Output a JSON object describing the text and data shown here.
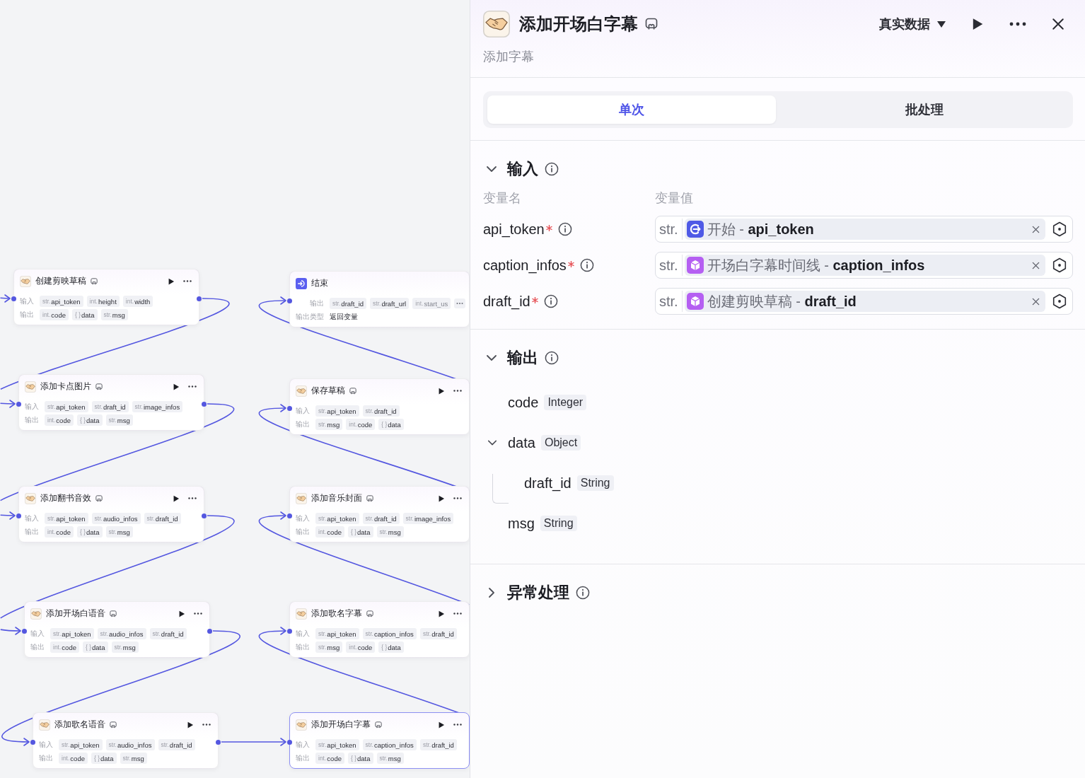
{
  "canvas": {
    "nodes": [
      {
        "kind": "plugin",
        "title": "创建剪映草稿",
        "selected": false,
        "rows": [
          {
            "kind": "params",
            "label": "输入",
            "params": [
              {
                "type": "str.",
                "name": "api_token"
              },
              {
                "type": "int.",
                "name": "height"
              },
              {
                "type": "int.",
                "name": "width"
              }
            ]
          },
          {
            "kind": "params",
            "label": "输出",
            "params": [
              {
                "type": "int.",
                "name": "code"
              },
              {
                "type": "{ }",
                "name": "data"
              },
              {
                "type": "str.",
                "name": "msg"
              }
            ]
          }
        ]
      },
      {
        "kind": "end",
        "title": "结束",
        "selected": false,
        "rows": [
          {
            "kind": "params",
            "label": "输出",
            "overflow": true,
            "params": [
              {
                "type": "str.",
                "name": "draft_id"
              },
              {
                "type": "str.",
                "name": "draft_url"
              },
              {
                "type": "int.",
                "name": "start_us"
              }
            ]
          },
          {
            "kind": "text",
            "label": "输出类型",
            "value": "返回变量"
          }
        ]
      },
      {
        "kind": "plugin",
        "title": "添加卡点图片",
        "selected": false,
        "rows": [
          {
            "kind": "params",
            "label": "输入",
            "params": [
              {
                "type": "str.",
                "name": "api_token"
              },
              {
                "type": "str.",
                "name": "draft_id"
              },
              {
                "type": "str.",
                "name": "image_infos"
              }
            ]
          },
          {
            "kind": "params",
            "label": "输出",
            "params": [
              {
                "type": "int.",
                "name": "code"
              },
              {
                "type": "{ }",
                "name": "data"
              },
              {
                "type": "str.",
                "name": "msg"
              }
            ]
          }
        ]
      },
      {
        "kind": "plugin",
        "title": "保存草稿",
        "selected": false,
        "rows": [
          {
            "kind": "params",
            "label": "输入",
            "params": [
              {
                "type": "str.",
                "name": "api_token"
              },
              {
                "type": "str.",
                "name": "draft_id"
              }
            ]
          },
          {
            "kind": "params",
            "label": "输出",
            "params": [
              {
                "type": "str.",
                "name": "msg"
              },
              {
                "type": "int.",
                "name": "code"
              },
              {
                "type": "{ }",
                "name": "data"
              }
            ]
          }
        ]
      },
      {
        "kind": "plugin",
        "title": "添加翻书音效",
        "selected": false,
        "rows": [
          {
            "kind": "params",
            "label": "输入",
            "params": [
              {
                "type": "str.",
                "name": "api_token"
              },
              {
                "type": "str.",
                "name": "audio_infos"
              },
              {
                "type": "str.",
                "name": "draft_id"
              }
            ]
          },
          {
            "kind": "params",
            "label": "输出",
            "params": [
              {
                "type": "int.",
                "name": "code"
              },
              {
                "type": "{ }",
                "name": "data"
              },
              {
                "type": "str.",
                "name": "msg"
              }
            ]
          }
        ]
      },
      {
        "kind": "plugin",
        "title": "添加音乐封面",
        "selected": false,
        "rows": [
          {
            "kind": "params",
            "label": "输入",
            "params": [
              {
                "type": "str.",
                "name": "api_token"
              },
              {
                "type": "str.",
                "name": "draft_id"
              },
              {
                "type": "str.",
                "name": "image_infos"
              }
            ]
          },
          {
            "kind": "params",
            "label": "输出",
            "params": [
              {
                "type": "int.",
                "name": "code"
              },
              {
                "type": "{ }",
                "name": "data"
              },
              {
                "type": "str.",
                "name": "msg"
              }
            ]
          }
        ]
      },
      {
        "kind": "plugin",
        "title": "添加开场白语音",
        "selected": false,
        "rows": [
          {
            "kind": "params",
            "label": "输入",
            "params": [
              {
                "type": "str.",
                "name": "api_token"
              },
              {
                "type": "str.",
                "name": "audio_infos"
              },
              {
                "type": "str.",
                "name": "draft_id"
              }
            ]
          },
          {
            "kind": "params",
            "label": "输出",
            "params": [
              {
                "type": "int.",
                "name": "code"
              },
              {
                "type": "{ }",
                "name": "data"
              },
              {
                "type": "str.",
                "name": "msg"
              }
            ]
          }
        ]
      },
      {
        "kind": "plugin",
        "title": "添加歌名字幕",
        "selected": false,
        "rows": [
          {
            "kind": "params",
            "label": "输入",
            "params": [
              {
                "type": "str.",
                "name": "api_token"
              },
              {
                "type": "str.",
                "name": "caption_infos"
              },
              {
                "type": "str.",
                "name": "draft_id"
              }
            ]
          },
          {
            "kind": "params",
            "label": "输出",
            "params": [
              {
                "type": "str.",
                "name": "msg"
              },
              {
                "type": "int.",
                "name": "code"
              },
              {
                "type": "{ }",
                "name": "data"
              }
            ]
          }
        ]
      },
      {
        "kind": "plugin",
        "title": "添加歌名语音",
        "selected": false,
        "rows": [
          {
            "kind": "params",
            "label": "输入",
            "params": [
              {
                "type": "str.",
                "name": "api_token"
              },
              {
                "type": "str.",
                "name": "audio_infos"
              },
              {
                "type": "str.",
                "name": "draft_id"
              }
            ]
          },
          {
            "kind": "params",
            "label": "输出",
            "params": [
              {
                "type": "int.",
                "name": "code"
              },
              {
                "type": "{ }",
                "name": "data"
              },
              {
                "type": "str.",
                "name": "msg"
              }
            ]
          }
        ]
      },
      {
        "kind": "plugin",
        "title": "添加开场白字幕",
        "selected": true,
        "rows": [
          {
            "kind": "params",
            "label": "输入",
            "params": [
              {
                "type": "str.",
                "name": "api_token"
              },
              {
                "type": "str.",
                "name": "caption_infos"
              },
              {
                "type": "str.",
                "name": "draft_id"
              }
            ]
          },
          {
            "kind": "params",
            "label": "输出",
            "params": [
              {
                "type": "int.",
                "name": "code"
              },
              {
                "type": "{ }",
                "name": "data"
              },
              {
                "type": "str.",
                "name": "msg"
              }
            ]
          }
        ]
      }
    ]
  },
  "panel": {
    "title": "添加开场白字幕",
    "subtitle": "添加字幕",
    "data_mode": "真实数据",
    "tabs": [
      {
        "label": "单次",
        "selected": true
      },
      {
        "label": "批处理",
        "selected": false
      }
    ],
    "input": {
      "title": "输入",
      "expanded": true,
      "columns": [
        "变量名",
        "变量值"
      ],
      "variables": [
        {
          "name": "api_token",
          "required": true,
          "type": "str.",
          "source": {
            "kind": "start",
            "text": "开始 - **api_token**"
          }
        },
        {
          "name": "caption_infos",
          "required": true,
          "type": "str.",
          "source": {
            "kind": "node",
            "text": "开场白字幕时间线 - **caption_infos**"
          }
        },
        {
          "name": "draft_id",
          "required": true,
          "type": "str.",
          "source": {
            "kind": "node",
            "text": "创建剪映草稿 - **draft_id**"
          }
        }
      ]
    },
    "output": {
      "title": "输出",
      "expanded": true,
      "fields": [
        {
          "name": "code",
          "type": "Integer"
        },
        {
          "name": "data",
          "type": "Object",
          "expanded": true,
          "children": [
            {
              "name": "draft_id",
              "type": "String"
            }
          ]
        },
        {
          "name": "msg",
          "type": "String"
        }
      ]
    },
    "exception": {
      "title": "异常处理",
      "expanded": false
    }
  }
}
